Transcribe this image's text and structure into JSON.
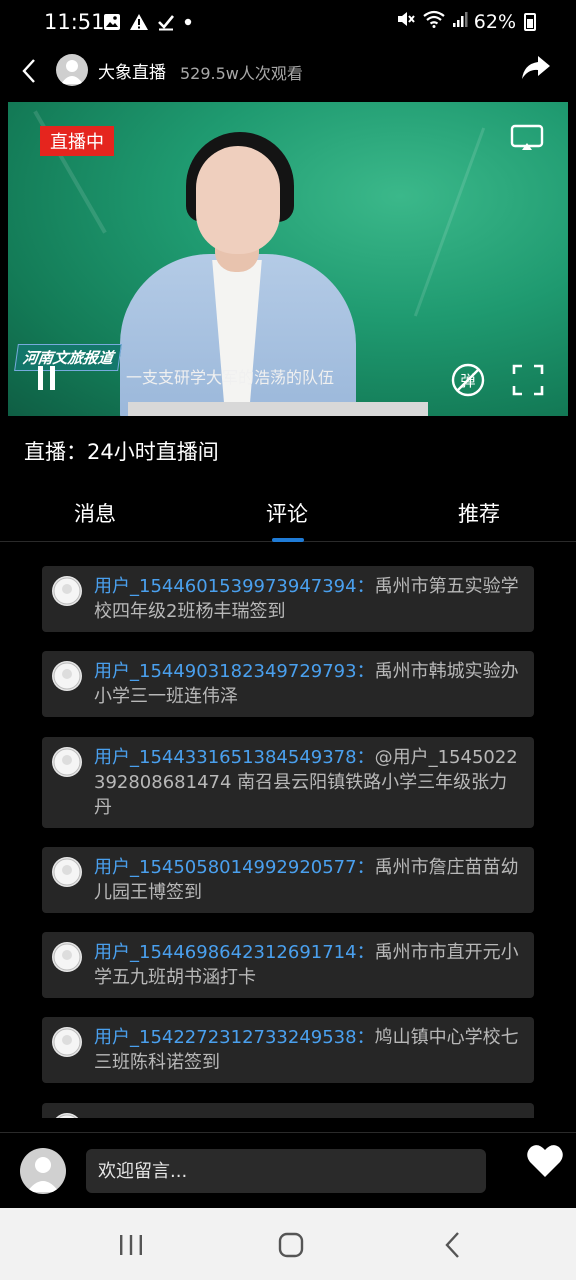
{
  "status_bar": {
    "time": "11:51",
    "battery": "62%",
    "left_icons": [
      "gallery-icon",
      "alert-icon",
      "check-icon",
      "dot-icon"
    ],
    "right_icons": [
      "mute-icon",
      "wifi-icon",
      "signal-icon",
      "battery-icon"
    ]
  },
  "header": {
    "channel_name": "大象直播",
    "view_count": "529.5w人次观看"
  },
  "video": {
    "live_badge": "直播中",
    "logo_text": "河南文旅报道",
    "subtitle": "一支支研学大军的浩荡的队伍",
    "danmaku_label": "弹"
  },
  "live_title": "直播：24小时直播间",
  "tabs": [
    {
      "label": "消息",
      "active": false
    },
    {
      "label": "评论",
      "active": true
    },
    {
      "label": "推荐",
      "active": false
    }
  ],
  "comments": [
    {
      "user": "用户_1544601539973947394：",
      "text": "禹州市第五实验学校四年级2班杨丰瑞签到"
    },
    {
      "user": "用户_1544903182349729793：",
      "text": "禹州市韩城实验办小学三一班连伟泽"
    },
    {
      "user": "用户_1544331651384549378：",
      "text": "@用户_1545022392808681474 南召县云阳镇铁路小学三年级张力丹"
    },
    {
      "user": "用户_1545058014992920577：",
      "text": "禹州市詹庄苗苗幼儿园王博签到"
    },
    {
      "user": "用户_1544698642312691714：",
      "text": "禹州市市直开元小学五九班胡书涵打卡"
    },
    {
      "user": "用户_1542272312733249538：",
      "text": "鸠山镇中心学校七三班陈科诺签到"
    }
  ],
  "footer": {
    "input_placeholder": "欢迎留言..."
  },
  "colors": {
    "accent_blue": "#4aa0ee",
    "tab_underline": "#1f7bd6",
    "live_red": "#e5251e"
  }
}
